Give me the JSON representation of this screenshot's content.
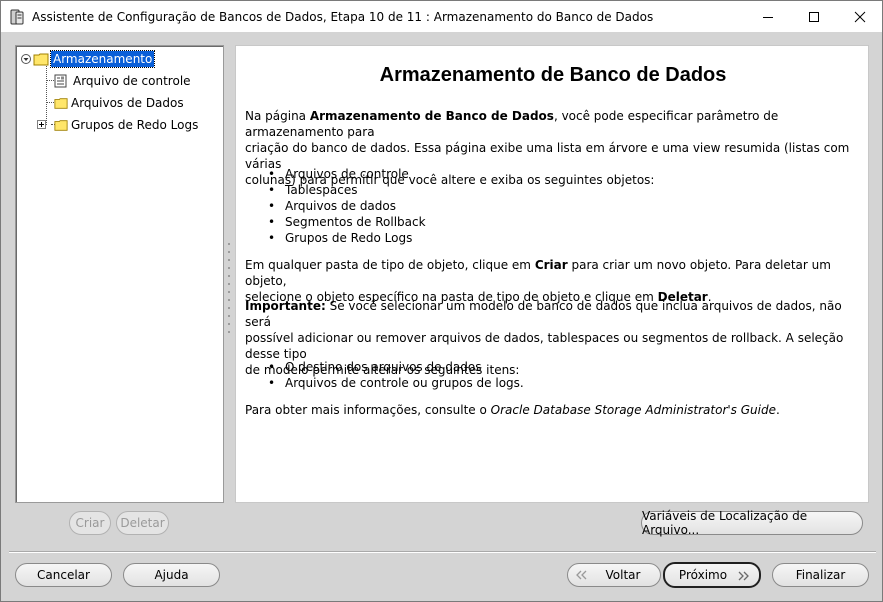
{
  "window": {
    "title": "Assistente de Configuração de Bancos de Dados, Etapa 10 de 11 : Armazenamento do Banco de Dados"
  },
  "tree": {
    "root_label": "Armazenamento",
    "items": [
      {
        "label": "Arquivo de controle",
        "icon": "control-file-icon"
      },
      {
        "label": "Arquivos de Dados",
        "icon": "folder-icon"
      },
      {
        "label": "Grupos de Redo Logs",
        "icon": "folder-icon"
      }
    ]
  },
  "tree_buttons": {
    "create": "Criar",
    "delete": "Deletar"
  },
  "help": {
    "heading": "Armazenamento de Banco de Dados",
    "p1_prefix": "Na página ",
    "p1_bold": "Armazenamento de Banco de Dados",
    "p1_line1_rest": ", você pode especificar parâmetro de armazenamento para",
    "p1_line2": "criação do banco de dados. Essa página exibe uma lista em árvore e uma view resumida (listas com várias",
    "p1_line3": "colunas) para permitir que você altere e exiba os seguintes objetos:",
    "objects": [
      "Arquivos de controle",
      "Tablespaces",
      "Arquivos de dados",
      "Segmentos de Rollback",
      "Grupos de Redo Logs"
    ],
    "p2_line1_a": "Em qualquer pasta de tipo de objeto, clique em ",
    "p2_line1_bold": "Criar",
    "p2_line1_b": " para criar um novo objeto. Para deletar um objeto,",
    "p2_line2_a": "selecione o objeto específico na pasta de tipo de objeto e clique em ",
    "p2_line2_bold": "Deletar",
    "p2_line2_b": ".",
    "p3_bold": "Importante:",
    "p3_line1_rest": " Se você selecionar um modelo de banco de dados que inclua arquivos de dados, não será",
    "p3_line2": "possível adicionar ou remover arquivos de dados, tablespaces ou segmentos de rollback. A seleção desse tipo",
    "p3_line3": "de modelo permite alterar os seguintes itens:",
    "items": [
      "O destino dos arquivos de dados",
      "Arquivos de controle ou grupos de logs."
    ],
    "p4_prefix": "Para obter mais informações, consulte o ",
    "p4_italic": "Oracle Database Storage Administrator's Guide",
    "p4_suffix": "."
  },
  "buttons": {
    "file_location": "Variáveis de Localização de Arquivo...",
    "cancel": "Cancelar",
    "help": "Ajuda",
    "back": "Voltar",
    "next": "Próximo",
    "finish": "Finalizar"
  }
}
